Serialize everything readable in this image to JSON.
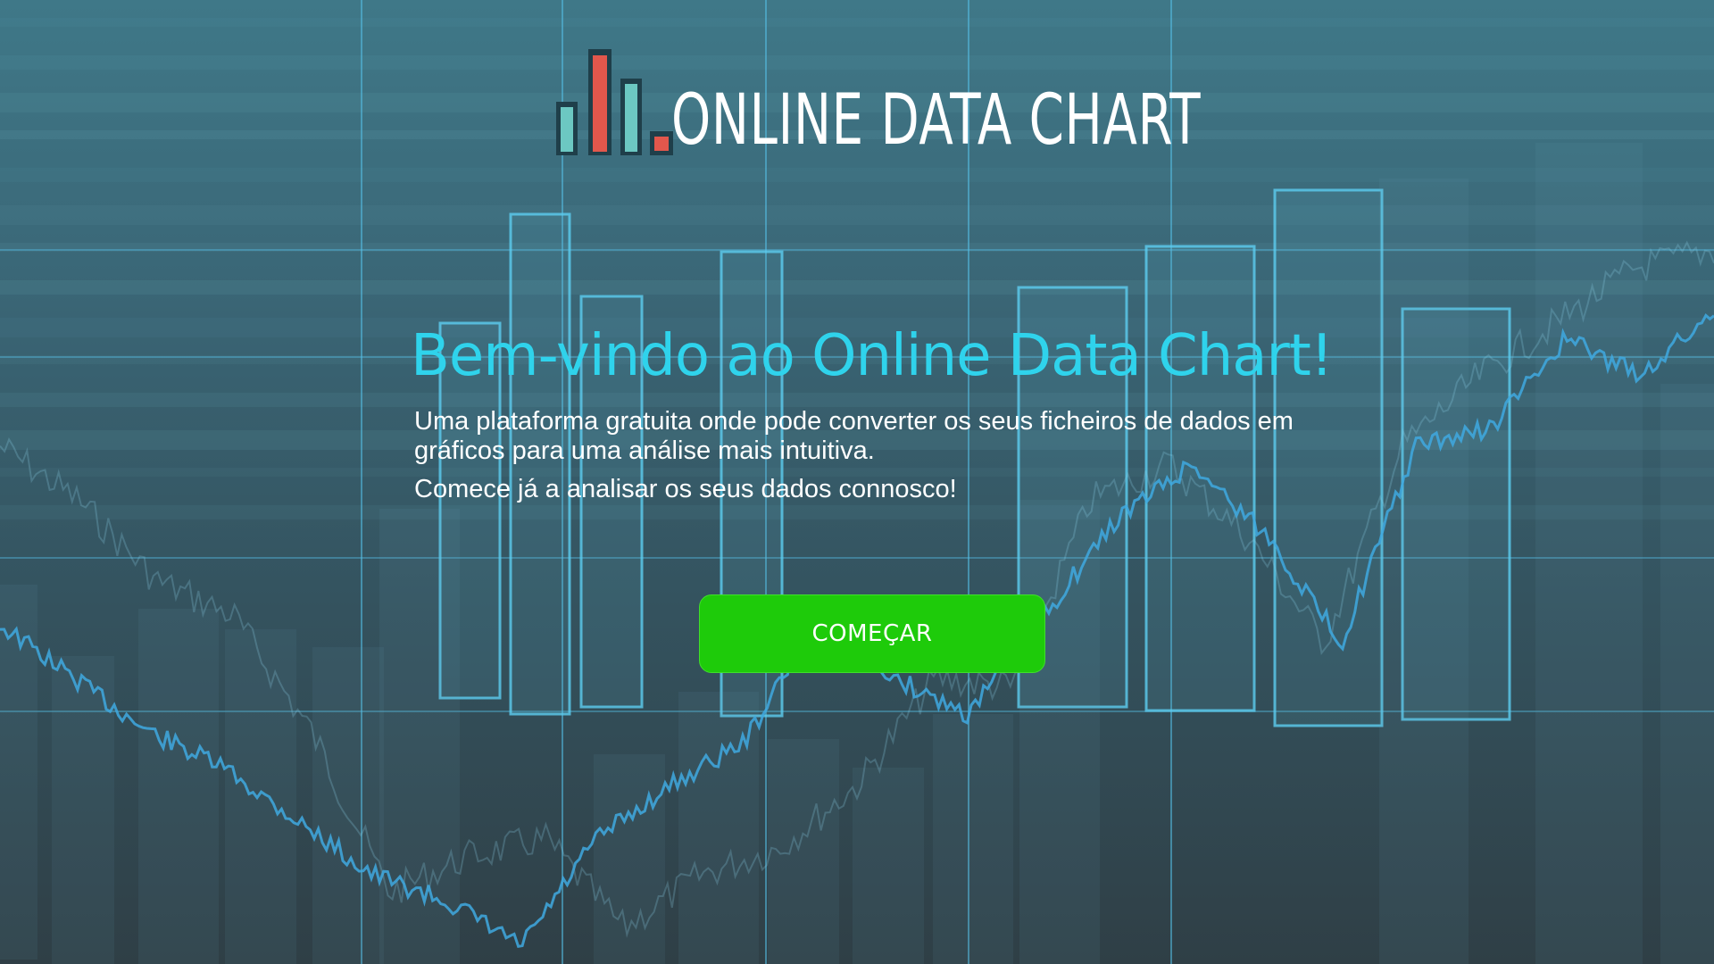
{
  "header": {
    "logo_text": "ONLINE DATA CHART",
    "logo_icon": "bar-chart-icon",
    "logo_colors": {
      "teal": "#6cc8c2",
      "red": "#e2574c",
      "outline": "#1f3f4a"
    }
  },
  "hero": {
    "title": "Bem-vindo ao Online Data Chart!",
    "subtitle": "Uma plataforma gratuita onde pode converter os seus ficheiros de dados em gráficos para uma análise mais intuitiva.",
    "subtitle2": "Comece já a analisar os seus dados connosco!",
    "title_color": "#2fd3ec"
  },
  "cta": {
    "label": "COMEÇAR",
    "color": "#1ecb0a"
  },
  "background": {
    "description_icon": "stock-chart-background",
    "line_color": "#4fb8e0"
  }
}
